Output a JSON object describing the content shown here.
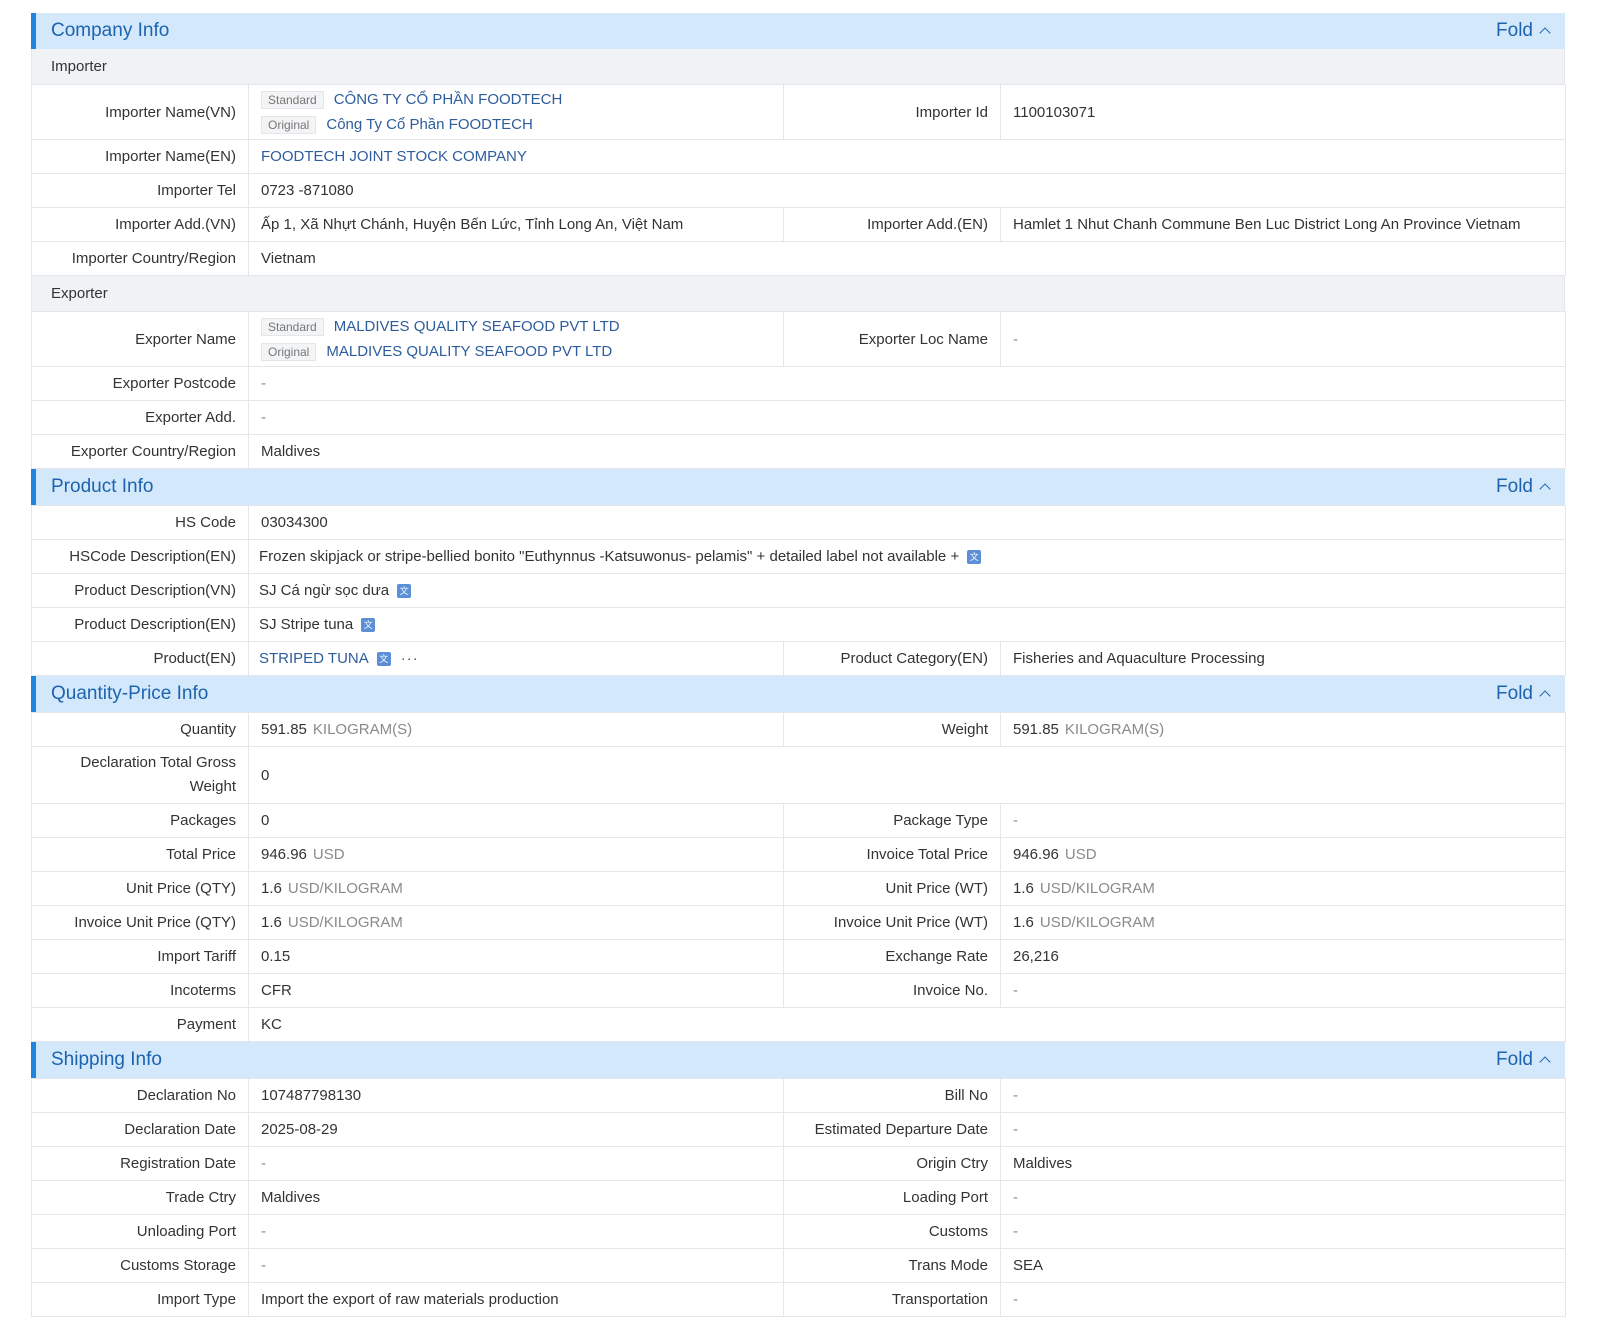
{
  "fold_label": "Fold",
  "company": {
    "title": "Company Info",
    "importer_heading": "Importer",
    "exporter_heading": "Exporter",
    "importer": {
      "name_vn_label": "Importer Name(VN)",
      "tag_standard": "Standard",
      "tag_original": "Original",
      "name_vn_standard": "CÔNG TY CỔ PHẦN FOODTECH",
      "name_vn_original": "Công Ty Cổ Phần FOODTECH",
      "id_label": "Importer Id",
      "id": "1100103071",
      "name_en_label": "Importer Name(EN)",
      "name_en": "FOODTECH JOINT STOCK COMPANY",
      "tel_label": "Importer Tel",
      "tel": "0723 -871080",
      "add_vn_label": "Importer Add.(VN)",
      "add_vn": "Ấp 1, Xã Nhựt Chánh, Huyện Bến Lức, Tỉnh Long An, Việt Nam",
      "add_en_label": "Importer Add.(EN)",
      "add_en": "Hamlet 1 Nhut Chanh Commune Ben Luc District Long An Province Vietnam",
      "country_label": "Importer Country/Region",
      "country": "Vietnam"
    },
    "exporter": {
      "name_label": "Exporter Name",
      "name_standard": "MALDIVES QUALITY SEAFOOD PVT LTD",
      "name_original": "MALDIVES QUALITY SEAFOOD PVT LTD",
      "loc_label": "Exporter Loc Name",
      "loc": "-",
      "postcode_label": "Exporter Postcode",
      "postcode": "-",
      "add_label": "Exporter Add.",
      "add": "-",
      "country_label": "Exporter Country/Region",
      "country": "Maldives"
    }
  },
  "product": {
    "title": "Product Info",
    "hs_label": "HS Code",
    "hs": "03034300",
    "hs_desc_label": "HSCode Description(EN)",
    "hs_desc": "Frozen skipjack or stripe-bellied bonito \"Euthynnus -Katsuwonus- pelamis\" + detailed label not available +",
    "desc_vn_label": "Product Description(VN)",
    "desc_vn": "SJ Cá ngừ sọc dưa",
    "desc_en_label": "Product Description(EN)",
    "desc_en": "SJ Stripe tuna",
    "product_en_label": "Product(EN)",
    "product_en": "STRIPED TUNA",
    "more": "···",
    "category_label": "Product Category(EN)",
    "category": "Fisheries and Aquaculture Processing",
    "translate_icon": "translate-icon"
  },
  "qp": {
    "title": "Quantity-Price Info",
    "quantity_label": "Quantity",
    "quantity": "591.85",
    "quantity_unit": "KILOGRAM(S)",
    "weight_label": "Weight",
    "weight": "591.85",
    "weight_unit": "KILOGRAM(S)",
    "gross_label": "Declaration Total Gross Weight",
    "gross": "0",
    "packages_label": "Packages",
    "packages": "0",
    "package_type_label": "Package Type",
    "package_type": "-",
    "total_price_label": "Total Price",
    "total_price": "946.96",
    "total_price_unit": "USD",
    "inv_total_label": "Invoice Total Price",
    "inv_total": "946.96",
    "inv_total_unit": "USD",
    "unit_qty_label": "Unit Price (QTY)",
    "unit_qty": "1.6",
    "unit_qty_unit": "USD/KILOGRAM",
    "unit_wt_label": "Unit Price (WT)",
    "unit_wt": "1.6",
    "unit_wt_unit": "USD/KILOGRAM",
    "inv_unit_qty_label": "Invoice Unit Price (QTY)",
    "inv_unit_qty": "1.6",
    "inv_unit_qty_unit": "USD/KILOGRAM",
    "inv_unit_wt_label": "Invoice Unit Price (WT)",
    "inv_unit_wt": "1.6",
    "inv_unit_wt_unit": "USD/KILOGRAM",
    "tariff_label": "Import Tariff",
    "tariff": "0.15",
    "rate_label": "Exchange Rate",
    "rate": "26,216",
    "incoterms_label": "Incoterms",
    "incoterms": "CFR",
    "invoice_no_label": "Invoice No.",
    "invoice_no": "-",
    "payment_label": "Payment",
    "payment": "KC"
  },
  "shipping": {
    "title": "Shipping Info",
    "decl_no_label": "Declaration No",
    "decl_no": "107487798130",
    "bill_label": "Bill No",
    "bill": "-",
    "decl_date_label": "Declaration Date",
    "decl_date": "2025-08-29",
    "est_dep_label": "Estimated Departure Date",
    "est_dep": "-",
    "reg_date_label": "Registration Date",
    "reg_date": "-",
    "origin_label": "Origin Ctry",
    "origin": "Maldives",
    "trade_label": "Trade Ctry",
    "trade": "Maldives",
    "loading_label": "Loading Port",
    "loading": "-",
    "unloading_label": "Unloading Port",
    "unloading": "-",
    "customs_label": "Customs",
    "customs": "-",
    "storage_label": "Customs Storage",
    "storage": "-",
    "trans_mode_label": "Trans Mode",
    "trans_mode": "SEA",
    "import_type_label": "Import Type",
    "import_type": "Import the export of raw materials production",
    "transportation_label": "Transportation",
    "transportation": "-"
  }
}
